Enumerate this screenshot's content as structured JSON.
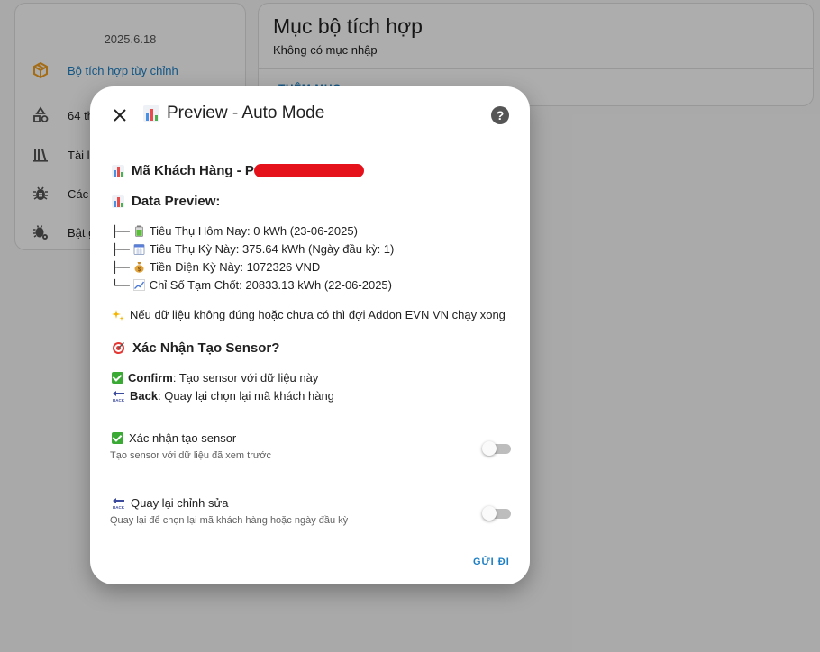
{
  "background": {
    "left_card": {
      "version": "2025.6.18",
      "integration_link": "Bộ tích hợp tùy chỉnh",
      "menu_items": [
        {
          "label": "64 th",
          "icon": "shapes-icon"
        },
        {
          "label": "Tài li",
          "icon": "library-icon"
        },
        {
          "label": "Các",
          "icon": "bug-icon"
        },
        {
          "label": "Bật g",
          "icon": "bug-gear-icon"
        }
      ]
    },
    "right_card": {
      "title": "Mục bộ tích hợp",
      "subtitle": "Không có mục nhập",
      "add_button": "THÊM MỤC"
    }
  },
  "dialog": {
    "title": "Preview - Auto Mode",
    "customer_heading": "Mã Khách Hàng - P",
    "data_preview_heading": "Data Preview:",
    "tree": [
      {
        "prefix": "├──",
        "icon": "battery-icon",
        "text": "Tiêu Thụ Hôm Nay: 0 kWh (23-06-2025)"
      },
      {
        "prefix": "├──",
        "icon": "calendar-icon",
        "text": "Tiêu Thụ Kỳ Này: 375.64 kWh (Ngày đầu kỳ: 1)"
      },
      {
        "prefix": "├──",
        "icon": "money-bag-icon",
        "text": "Tiền Điện Kỳ Này: 1072326 VNĐ"
      },
      {
        "prefix": "└──",
        "icon": "chart-increasing-icon",
        "text": "Chỉ Số Tạm Chốt: 20833.13 kWh (22-06-2025)"
      }
    ],
    "note": "Nếu dữ liệu không đúng hoặc chưa có thì đợi Addon EVN VN chạy xong",
    "confirm_heading": "Xác Nhận Tạo Sensor?",
    "confirm_line": {
      "bold": "Confirm",
      "rest": ": Tạo sensor với dữ liệu này"
    },
    "back_line": {
      "bold": "Back",
      "rest": ": Quay lại chọn lại mã khách hàng"
    },
    "options": [
      {
        "label": "Xác nhận tạo sensor",
        "description": "Tạo sensor với dữ liệu đã xem trước",
        "enabled": false
      },
      {
        "label": "Quay lại chỉnh sửa",
        "description": "Quay lại để chọn lại mã khách hàng hoặc ngày đầu kỳ",
        "enabled": false
      }
    ],
    "submit_label": "GỬI ĐI",
    "back_emoji_text": "BACK"
  },
  "colors": {
    "accent": "#1c7fc4",
    "redaction": "#e5121b",
    "check": "#3aaa35",
    "scrim": "rgba(0,0,0,0.32)"
  }
}
